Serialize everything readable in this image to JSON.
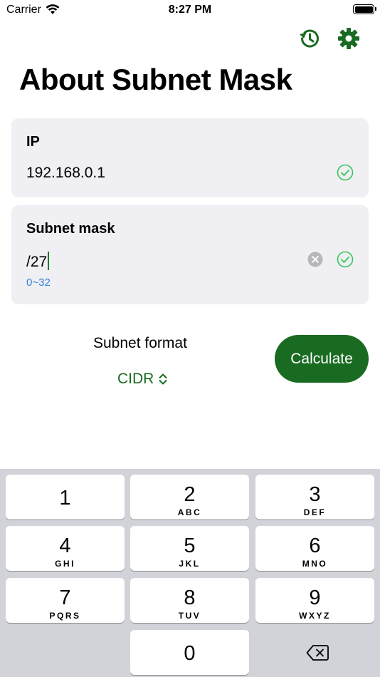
{
  "status_bar": {
    "carrier": "Carrier",
    "time": "8:27 PM"
  },
  "header": {
    "title": "About Subnet Mask"
  },
  "ip_card": {
    "label": "IP",
    "value": "192.168.0.1"
  },
  "mask_card": {
    "label": "Subnet mask",
    "value": "/27",
    "hint": "0~32"
  },
  "format": {
    "label": "Subnet format",
    "selected": "CIDR"
  },
  "calculate": {
    "label": "Calculate"
  },
  "keypad": [
    {
      "num": "1",
      "letters": ""
    },
    {
      "num": "2",
      "letters": "ABC"
    },
    {
      "num": "3",
      "letters": "DEF"
    },
    {
      "num": "4",
      "letters": "GHI"
    },
    {
      "num": "5",
      "letters": "JKL"
    },
    {
      "num": "6",
      "letters": "MNO"
    },
    {
      "num": "7",
      "letters": "PQRS"
    },
    {
      "num": "8",
      "letters": "TUV"
    },
    {
      "num": "9",
      "letters": "WXYZ"
    },
    {
      "num": "0",
      "letters": ""
    }
  ],
  "colors": {
    "accent": "#1a6b22",
    "valid": "#34c759",
    "hint": "#2f7fd6",
    "card": "#efeff4",
    "keyboard": "#d1d3d9"
  },
  "icons": [
    "wifi-icon",
    "battery-icon",
    "history-icon",
    "gear-icon",
    "check-icon",
    "clear-icon",
    "chevron-updown-icon",
    "delete-icon"
  ]
}
